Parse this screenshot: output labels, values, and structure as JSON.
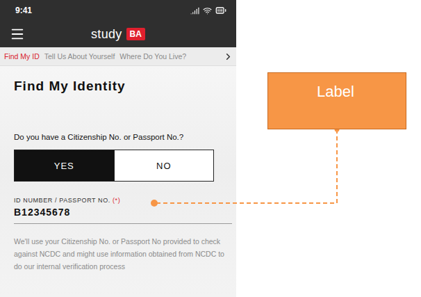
{
  "status_bar": {
    "time": "9:41"
  },
  "header": {
    "brand": "study",
    "badge": "BA"
  },
  "steps": [
    {
      "label": "Find My ID",
      "selected": true
    },
    {
      "label": "Tell Us About Yourself",
      "selected": false
    },
    {
      "label": "Where Do You Live?",
      "selected": false
    }
  ],
  "title": "Find My Identity",
  "question": "Do you have a Citizenship No. or Passport No.?",
  "options": [
    {
      "label": "YES",
      "selected": true
    },
    {
      "label": "NO",
      "selected": false
    }
  ],
  "field": {
    "label": "ID NUMBER / PASSPORT NO.",
    "required_mark": "(*)",
    "value": "B12345678"
  },
  "helper": "We'll use your Citizenship No. or Passport No provided to check against NCDC and might use information obtained from NCDC to do our internal verification process",
  "callout": {
    "label": "Label"
  }
}
